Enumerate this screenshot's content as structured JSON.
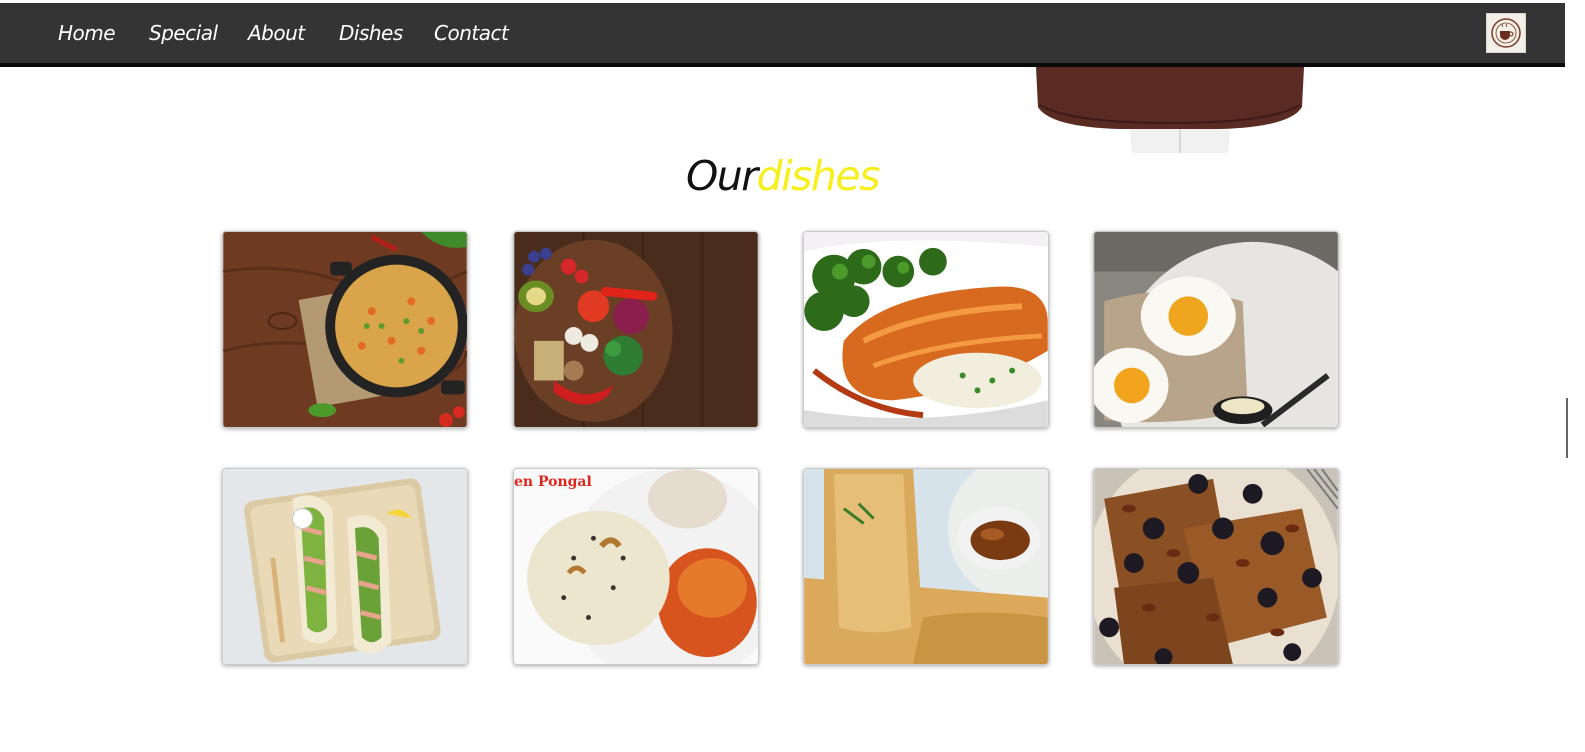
{
  "nav": {
    "links": [
      {
        "label": "Home"
      },
      {
        "label": "Special"
      },
      {
        "label": "About"
      },
      {
        "label": "Dishes"
      },
      {
        "label": "Contact"
      }
    ],
    "logo_icon": "cafe-logo-icon"
  },
  "section": {
    "title_part1": "Our",
    "title_part2": "dishes",
    "accent_color": "#f6ef1c"
  },
  "dishes": [
    {
      "icon": "fried-rice-skillet-image"
    },
    {
      "icon": "vegetable-board-image"
    },
    {
      "icon": "glazed-salmon-image"
    },
    {
      "icon": "fried-eggs-toast-image"
    },
    {
      "icon": "pita-sandwich-image"
    },
    {
      "icon": "ven-pongal-image",
      "caption": "en Pongal"
    },
    {
      "icon": "dosa-image"
    },
    {
      "icon": "berry-french-toast-image"
    }
  ],
  "colors": {
    "navbar": "#343434",
    "apron": "#5a2b22"
  }
}
